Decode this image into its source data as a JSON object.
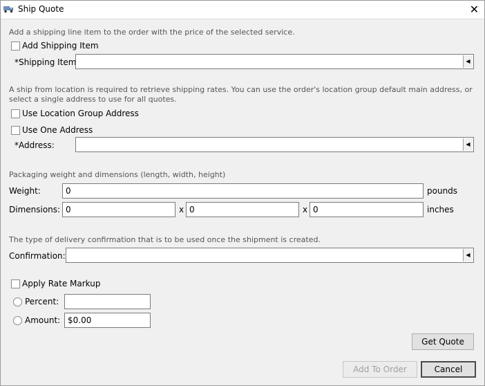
{
  "window": {
    "title": "Ship Quote",
    "close_glyph": "✕"
  },
  "shipping_item_section": {
    "description": "Add a shipping line item to the order with the price of the selected service.",
    "add_shipping_item_label": "Add Shipping Item",
    "add_shipping_item_checked": false,
    "shipping_item_label": "*Shipping Item:",
    "shipping_item_value": ""
  },
  "ship_from_section": {
    "description": "A ship from location is required to retrieve shipping rates. You can use the order's location group default main address, or select a single address to use for all quotes.",
    "use_location_group_label": "Use Location Group Address",
    "use_location_group_checked": false,
    "use_one_address_label": "Use One Address",
    "use_one_address_checked": false,
    "address_label": "*Address:",
    "address_value": ""
  },
  "packaging_section": {
    "description": "Packaging weight and dimensions (length, width, height)",
    "weight_label": "Weight:",
    "weight_value": "0",
    "weight_unit": "pounds",
    "dimensions_label": "Dimensions:",
    "length_value": "0",
    "width_value": "0",
    "height_value": "0",
    "separator": "x",
    "dimensions_unit": "inches"
  },
  "confirmation_section": {
    "description": "The type of delivery confirmation that is to be used once the shipment is created.",
    "confirmation_label": "Confirmation:",
    "confirmation_value": ""
  },
  "markup_section": {
    "apply_rate_markup_label": "Apply Rate Markup",
    "apply_rate_markup_checked": false,
    "percent_label": "Percent:",
    "percent_value": "",
    "amount_label": "Amount:",
    "amount_value": "$0.00"
  },
  "buttons": {
    "get_quote": "Get Quote",
    "add_to_order": "Add To Order",
    "cancel": "Cancel"
  },
  "icons": {
    "title_icon": "truck-icon",
    "combo_arrow": "caret-left-icon"
  }
}
